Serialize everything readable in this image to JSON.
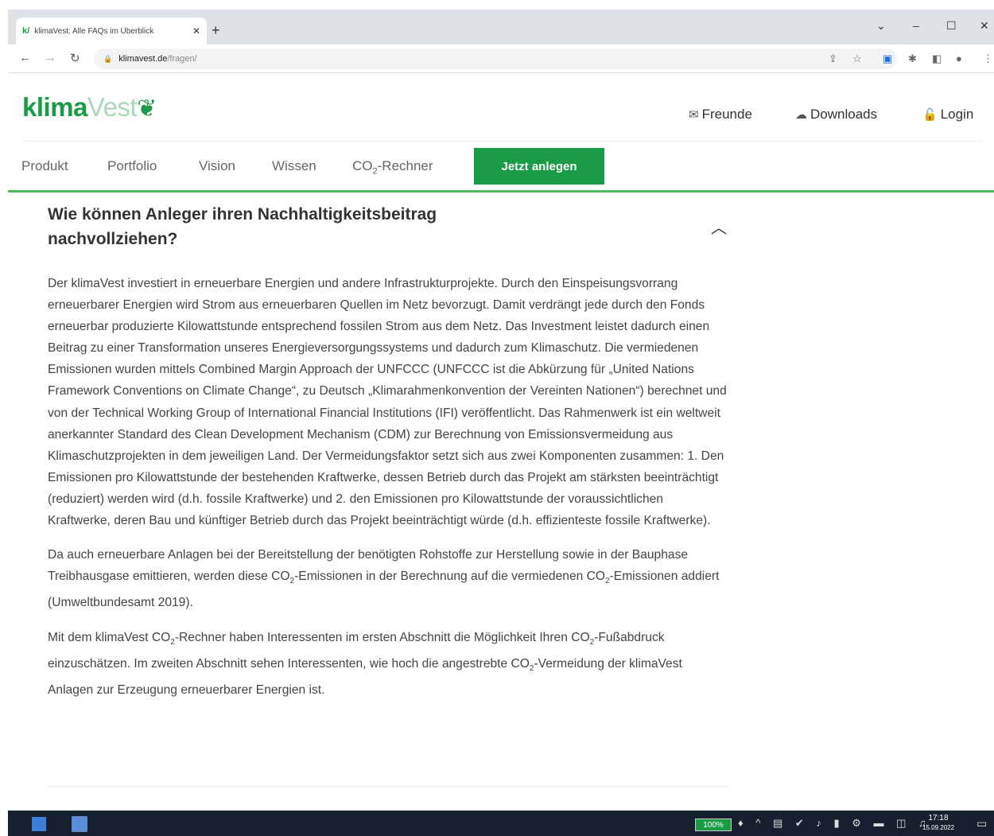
{
  "browser": {
    "tab_favicon": "k/",
    "tab_title": "klimaVest: Alle FAQs im Überblick",
    "tab_close": "✕",
    "new_tab": "+",
    "url_host": "klimavest.de",
    "url_path": "/fragen/",
    "window_controls": [
      "⌄",
      "–",
      "☐",
      "✕"
    ]
  },
  "site": {
    "logo_klima": "klima",
    "logo_vest": "Vest",
    "utility_links": [
      {
        "label": "Freunde",
        "icon": "mail-icon"
      },
      {
        "label": "Downloads",
        "icon": "cloud-download-icon"
      },
      {
        "label": "Login",
        "icon": "lock-icon"
      }
    ],
    "nav": [
      "Produkt",
      "Portfolio",
      "Vision",
      "Wissen"
    ],
    "nav_co2_prefix": "CO",
    "nav_co2_sub": "2",
    "nav_co2_suffix": "-Rechner",
    "cta": "Jetzt anlegen",
    "accent_color": "#1a9b47"
  },
  "faq": {
    "question": "Wie können Anleger ihren Nachhaltigkeitsbeitrag nachvollziehen?",
    "expanded_icon": "chevron-up-icon",
    "paragraph1": "Der klimaVest investiert in erneuerbare Energien und andere Infrastrukturprojekte. Durch den Einspeisungsvorrang erneuerbarer Energien wird Strom aus erneuerbaren Quellen im Netz bevorzugt. Damit verdrängt jede durch den Fonds erneuerbar produzierte Kilowattstunde entsprechend fossilen Strom aus dem Netz. Das Investment leistet dadurch einen Beitrag zu einer Transformation unseres Energieversorgungssystems und dadurch zum Klimaschutz. Die vermiedenen Emissionen wurden mittels Combined Margin Approach der UNFCCC (UNFCCC ist die Abkürzung für „United Nations Framework Conventions on Climate Change“, zu Deutsch „Klimarahmenkonvention der Vereinten Nationen“) berechnet und von der Technical Working Group of International Financial Institutions (IFI) veröffentlicht. Das Rahmenwerk ist ein weltweit anerkannter Standard des Clean Development Mechanism (CDM) zur Berechnung von Emissionsvermeidung aus Klimaschutzprojekten in dem jeweiligen Land. Der Vermeidungsfaktor setzt sich aus zwei Komponenten zusammen: 1. Den Emissionen pro Kilowattstunde der bestehenden Kraftwerke, dessen Betrieb durch das Projekt am stärksten beeinträchtigt (reduziert) werden wird (d.h. fossile Kraftwerke) und 2. den Emissionen pro Kilowattstunde der voraussichtlichen Kraftwerke, deren Bau und künftiger Betrieb durch das Projekt beeinträchtigt würde (d.h. effizienteste fossile Kraftwerke).",
    "paragraph2": {
      "a": "Da auch erneuerbare Anlagen bei der Bereitstellung der benötigten Rohstoffe zur Herstellung sowie in der Bauphase Treibhausgase emittieren, werden diese CO",
      "sub1": "2",
      "b": "-Emissionen in der Berechnung auf die vermiedenen CO",
      "sub2": "2",
      "c": "-Emissionen addiert (Umweltbundesamt 2019)."
    },
    "paragraph3": {
      "a": "Mit dem klimaVest CO",
      "sub1": "2",
      "b": "-Rechner haben Interessenten im ersten Abschnitt die Möglichkeit Ihren CO",
      "sub2": "2",
      "c": "-Fußabdruck einzuschätzen. Im zweiten Abschnitt sehen Interessenten, wie hoch die angestrebte CO",
      "sub3": "2",
      "d": "-Vermeidung der klimaVest Anlagen zur Erzeugung erneuerbarer Energien ist."
    }
  },
  "taskbar": {
    "battery": "100%",
    "time": "17:18",
    "date": "15.09.2022"
  }
}
